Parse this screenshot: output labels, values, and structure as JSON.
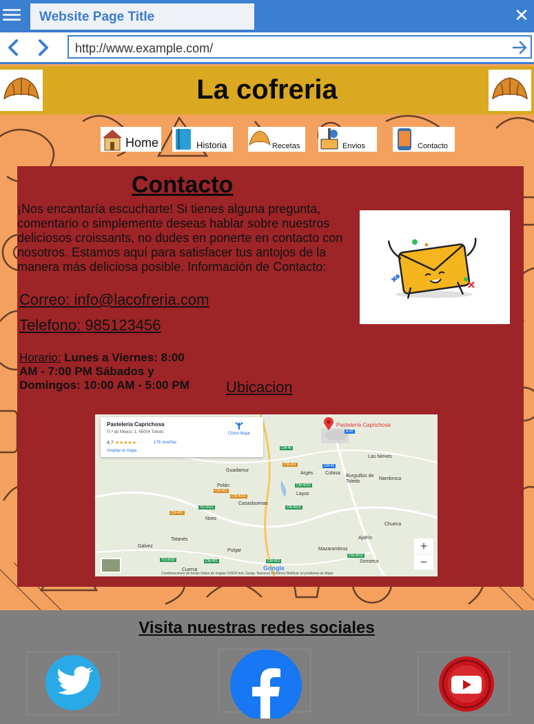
{
  "browser": {
    "tab_title": "Website Page Title",
    "url": "http://www.example.com/"
  },
  "site": {
    "title": "La cofreria"
  },
  "menu": {
    "items": [
      {
        "label": "Home"
      },
      {
        "label": "Historia"
      },
      {
        "label": "Recetas"
      },
      {
        "label": "Envios"
      },
      {
        "label": "Contacto"
      }
    ]
  },
  "contact": {
    "heading": "Contacto",
    "intro": "¡Nos encantaría escucharte! Si tienes alguna pregunta, comentario o simplemente deseas hablar sobre nuestros deliciosos croissants, no dudes en ponerte en contacto con nosotros. Estamos aquí para satisfacer tus antojos de la manera más deliciosa posible. Información de Contacto:",
    "email": "Correo: info@lacofreria.com ",
    "phone": "Telefono: 985123456",
    "hours_label": "Horario:",
    "hours_value": "Lunes a Viernes: 8:00 AM - 7:00 PM Sábados y Domingos: 10:00 AM - 5:00 PM",
    "location_label": "Ubicacion"
  },
  "map": {
    "place_name": "Pastelería Caprichosa",
    "address": "Tr.ª de Mejico, 1, 45004 Toledo",
    "rating": "4,7",
    "stars": "★★★★★",
    "reviews": "178 reseñas",
    "enlarge": "Ampliar el mapa",
    "directions": "Cómo llegar",
    "pin_label": "Pastelería Caprichosa",
    "towns": [
      "Las Nieves",
      "Guadamur",
      "Argés",
      "Cobisa",
      "Burguillos de Toledo",
      "Nambroca",
      "Polán",
      "Layos",
      "Casasbuenas",
      "Noez",
      "Chueca",
      "Totanés",
      "Gálvez",
      "Ajofrín",
      "Pulgar",
      "Mazarambroz",
      "Sonseca",
      "Cuerva"
    ],
    "roads": [
      "CM-40",
      "A-42",
      "CM-401",
      "CM-40",
      "CM-4013",
      "CM-401",
      "CM-4013",
      "TO-3521",
      "CM-4013",
      "CM-401",
      "CM-4013",
      "TO-3632",
      "CM-401",
      "CM-410"
    ],
    "zoom_in": "+",
    "zoom_out": "−",
    "google": "Google",
    "footer": "Combinaciones de teclas   Datos de mapas ©2024 Inst. Geogr. Nacional   Términos   Notificar un problema de Maps"
  },
  "social": {
    "heading": "Visita nuestras redes sociales",
    "networks": [
      "twitter-icon",
      "facebook-icon",
      "youtube-icon"
    ]
  },
  "colors": {
    "chrome_blue": "#3b7fd0",
    "header_gold": "#dba821",
    "panel_red": "#9d2427",
    "background_orange": "#f4a15f",
    "footer_gray": "#7f7f7f"
  }
}
